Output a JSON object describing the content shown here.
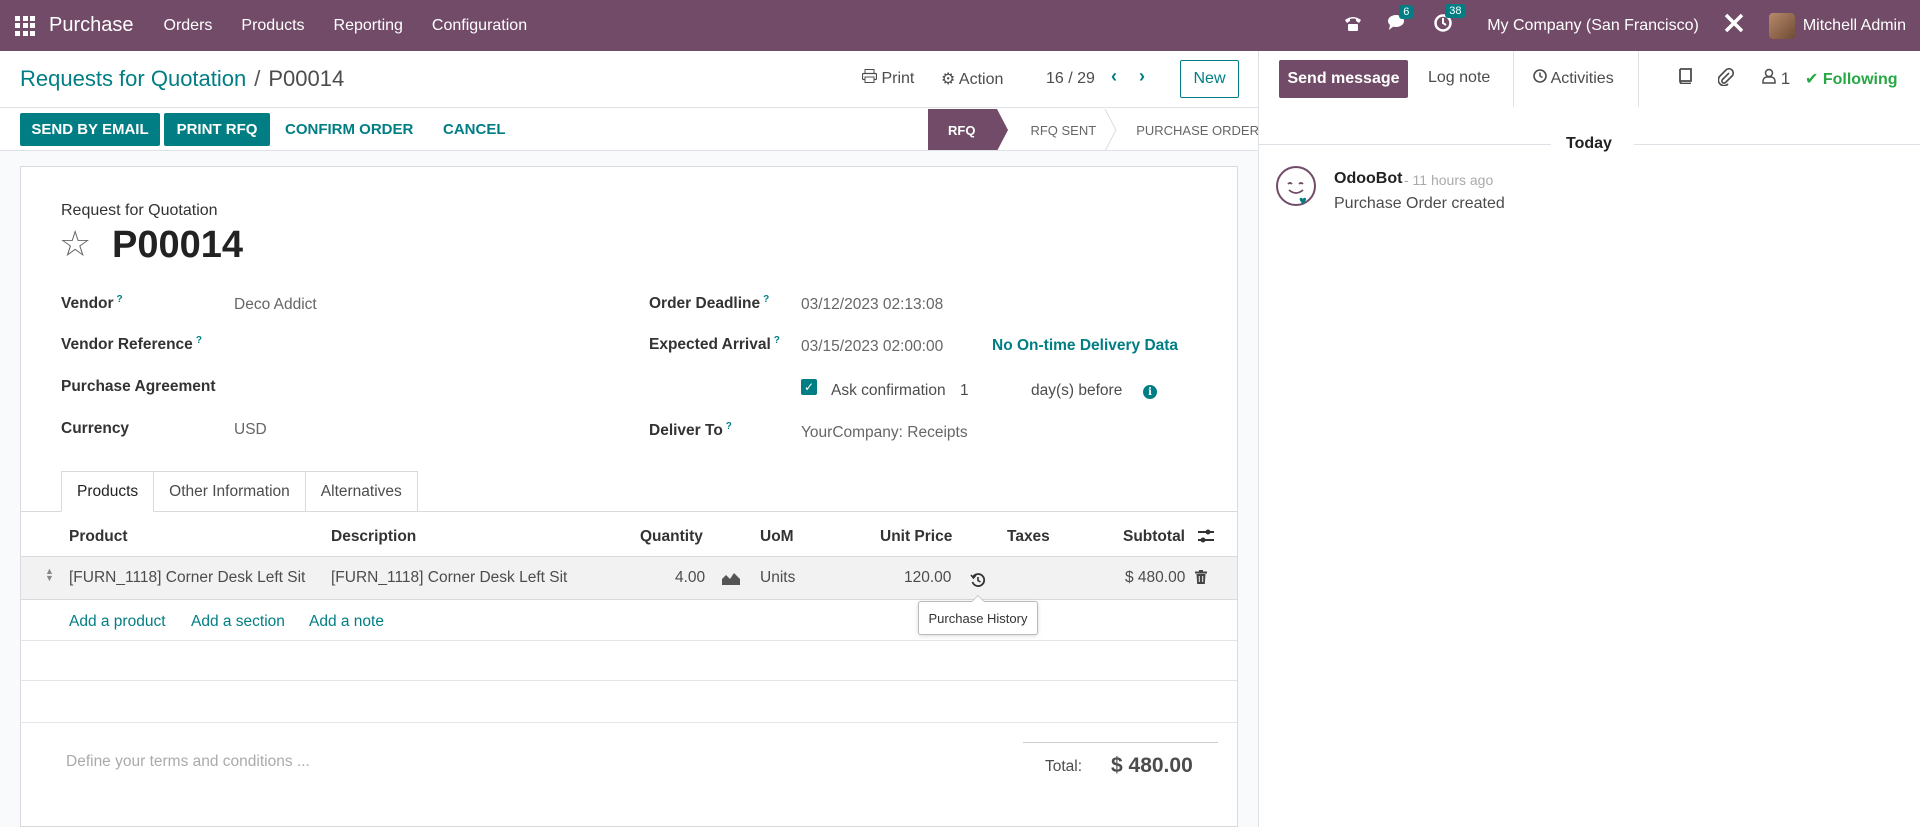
{
  "topbar": {
    "app_name": "Purchase",
    "menu": [
      "Orders",
      "Products",
      "Reporting",
      "Configuration"
    ],
    "chat_badge": "6",
    "activity_badge": "38",
    "company": "My Company (San Francisco)",
    "user": "Mitchell Admin"
  },
  "control_panel": {
    "breadcrumb_parent": "Requests for Quotation",
    "breadcrumb_sep": "/",
    "breadcrumb_current": "P00014",
    "print_label": "Print",
    "action_label": "Action",
    "pager": "16 / 29",
    "new_label": "New"
  },
  "statusbar": {
    "buttons": {
      "send_email": "SEND BY EMAIL",
      "print_rfq": "PRINT RFQ",
      "confirm": "CONFIRM ORDER",
      "cancel": "CANCEL"
    },
    "stages": [
      "RFQ",
      "RFQ SENT",
      "PURCHASE ORDER"
    ],
    "active_stage": "RFQ"
  },
  "form": {
    "doc_type": "Request for Quotation",
    "reference": "P00014",
    "fields": {
      "vendor_label": "Vendor",
      "vendor_value": "Deco Addict",
      "vendor_ref_label": "Vendor Reference",
      "agreement_label": "Purchase Agreement",
      "currency_label": "Currency",
      "currency_value": "USD",
      "deadline_label": "Order Deadline",
      "deadline_value": "03/12/2023 02:13:08",
      "arrival_label": "Expected Arrival",
      "arrival_value": "03/15/2023 02:00:00",
      "ontime_text": "No On-time Delivery Data",
      "ask_confirm_label": "Ask confirmation",
      "ask_confirm_days": "1",
      "ask_confirm_suffix": "day(s) before",
      "deliver_label": "Deliver To",
      "deliver_value": "YourCompany: Receipts",
      "help_mark": "?"
    },
    "tabs": [
      "Products",
      "Other Information",
      "Alternatives"
    ],
    "active_tab": "Products",
    "table": {
      "headers": {
        "product": "Product",
        "description": "Description",
        "quantity": "Quantity",
        "uom": "UoM",
        "unit_price": "Unit Price",
        "taxes": "Taxes",
        "subtotal": "Subtotal"
      },
      "rows": [
        {
          "product": "[FURN_1118] Corner Desk Left Sit",
          "description": "[FURN_1118] Corner Desk Left Sit",
          "quantity": "4.00",
          "uom": "Units",
          "unit_price": "120.00",
          "taxes": "",
          "subtotal": "$ 480.00"
        }
      ],
      "add_links": [
        "Add a product",
        "Add a section",
        "Add a note"
      ],
      "tooltip": "Purchase History"
    },
    "terms_placeholder": "Define your terms and conditions ...",
    "total_label": "Total:",
    "total_value": "$ 480.00"
  },
  "chatter": {
    "send_message": "Send message",
    "log_note": "Log note",
    "activities": "Activities",
    "followers_count": "1",
    "following": "Following",
    "date_separator": "Today",
    "messages": [
      {
        "author": "OdooBot",
        "time": "- 11 hours ago",
        "body": "Purchase Order created"
      }
    ]
  },
  "colors": {
    "brand": "#714b67",
    "accent": "#017e84"
  }
}
